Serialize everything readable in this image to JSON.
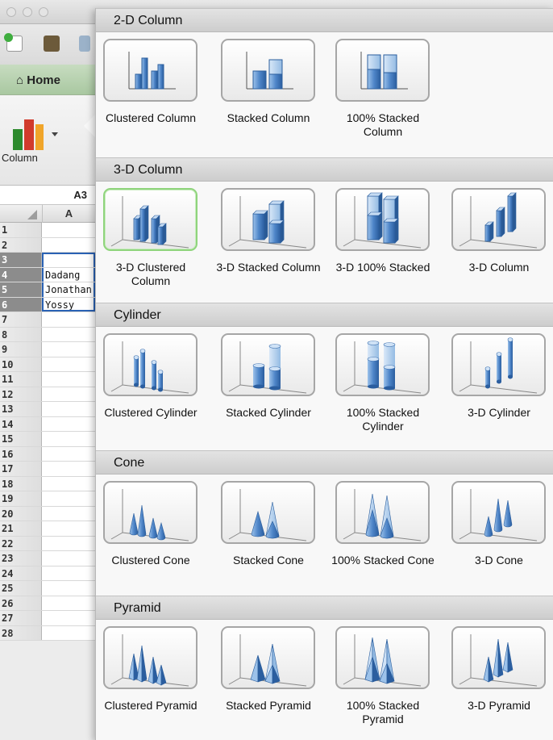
{
  "window": {
    "home_tab": "Home",
    "ribbon_column_label": "Column",
    "name_box": "A3",
    "column_header": "A"
  },
  "sheet": {
    "rows": [
      {
        "num": "1",
        "value": ""
      },
      {
        "num": "2",
        "value": ""
      },
      {
        "num": "3",
        "value": ""
      },
      {
        "num": "4",
        "value": "Dadang"
      },
      {
        "num": "5",
        "value": "Jonathan"
      },
      {
        "num": "6",
        "value": "Yossy"
      },
      {
        "num": "7",
        "value": ""
      },
      {
        "num": "8",
        "value": ""
      },
      {
        "num": "9",
        "value": ""
      },
      {
        "num": "10",
        "value": ""
      },
      {
        "num": "11",
        "value": ""
      },
      {
        "num": "12",
        "value": ""
      },
      {
        "num": "13",
        "value": ""
      },
      {
        "num": "14",
        "value": ""
      },
      {
        "num": "15",
        "value": ""
      },
      {
        "num": "16",
        "value": ""
      },
      {
        "num": "17",
        "value": ""
      },
      {
        "num": "18",
        "value": ""
      },
      {
        "num": "19",
        "value": ""
      },
      {
        "num": "20",
        "value": ""
      },
      {
        "num": "21",
        "value": ""
      },
      {
        "num": "22",
        "value": ""
      },
      {
        "num": "23",
        "value": ""
      },
      {
        "num": "24",
        "value": ""
      },
      {
        "num": "25",
        "value": ""
      },
      {
        "num": "26",
        "value": ""
      },
      {
        "num": "27",
        "value": ""
      },
      {
        "num": "28",
        "value": ""
      }
    ]
  },
  "gallery": {
    "sections": [
      {
        "title": "2-D Column",
        "items": [
          {
            "label": "Clustered Column",
            "icon": "clustered-column-icon",
            "kind": "bar-clustered",
            "selected": false
          },
          {
            "label": "Stacked Column",
            "icon": "stacked-column-icon",
            "kind": "bar-stacked",
            "selected": false
          },
          {
            "label": "100% Stacked Column",
            "icon": "percent-stacked-column-icon",
            "kind": "bar-100",
            "selected": false
          }
        ]
      },
      {
        "title": "3-D Column",
        "items": [
          {
            "label": "3-D Clustered Column",
            "icon": "3d-clustered-column-icon",
            "kind": "box-clustered",
            "selected": true
          },
          {
            "label": "3-D Stacked Column",
            "icon": "3d-stacked-column-icon",
            "kind": "box-stacked",
            "selected": false
          },
          {
            "label": "3-D 100% Stacked",
            "icon": "3d-percent-stacked-column-icon",
            "kind": "box-100",
            "selected": false
          },
          {
            "label": "3-D Column",
            "icon": "3d-column-icon",
            "kind": "box-3d",
            "selected": false
          }
        ]
      },
      {
        "title": "Cylinder",
        "items": [
          {
            "label": "Clustered Cylinder",
            "icon": "clustered-cylinder-icon",
            "kind": "cyl-clustered",
            "selected": false
          },
          {
            "label": "Stacked Cylinder",
            "icon": "stacked-cylinder-icon",
            "kind": "cyl-stacked",
            "selected": false
          },
          {
            "label": "100% Stacked Cylinder",
            "icon": "percent-stacked-cylinder-icon",
            "kind": "cyl-100",
            "selected": false
          },
          {
            "label": "3-D Cylinder",
            "icon": "3d-cylinder-icon",
            "kind": "cyl-3d",
            "selected": false
          }
        ]
      },
      {
        "title": "Cone",
        "items": [
          {
            "label": "Clustered Cone",
            "icon": "clustered-cone-icon",
            "kind": "cone-clustered",
            "selected": false
          },
          {
            "label": "Stacked Cone",
            "icon": "stacked-cone-icon",
            "kind": "cone-stacked",
            "selected": false
          },
          {
            "label": "100% Stacked Cone",
            "icon": "percent-stacked-cone-icon",
            "kind": "cone-100",
            "selected": false
          },
          {
            "label": "3-D Cone",
            "icon": "3d-cone-icon",
            "kind": "cone-3d",
            "selected": false
          }
        ]
      },
      {
        "title": "Pyramid",
        "items": [
          {
            "label": "Clustered Pyramid",
            "icon": "clustered-pyramid-icon",
            "kind": "pyr-clustered",
            "selected": false
          },
          {
            "label": "Stacked Pyramid",
            "icon": "stacked-pyramid-icon",
            "kind": "pyr-stacked",
            "selected": false
          },
          {
            "label": "100% Stacked Pyramid",
            "icon": "percent-stacked-pyramid-icon",
            "kind": "pyr-100",
            "selected": false
          },
          {
            "label": "3-D Pyramid",
            "icon": "3d-pyramid-icon",
            "kind": "pyr-3d",
            "selected": false
          }
        ]
      }
    ]
  }
}
